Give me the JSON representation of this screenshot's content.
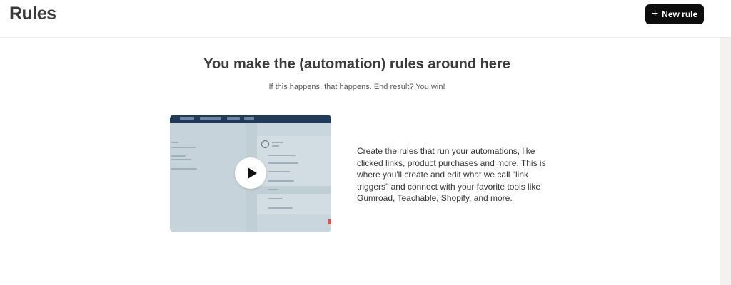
{
  "header": {
    "title": "Rules",
    "new_rule_label": "New rule",
    "new_rule_icon": "plus-icon"
  },
  "hero": {
    "title": "You make the (automation) rules around here",
    "subtitle": "If this happens, that happens. End result? You win!"
  },
  "video": {
    "play_icon": "play-icon"
  },
  "description": "Create the rules that run your automations, like clicked links, product purchases and more. This is where you'll create and edit what we call \"link triggers\" and connect with your favorite tools like Gumroad, Teachable, Shopify, and more.",
  "colors": {
    "button_bg": "#0d0d0d",
    "title_text": "#3b3b3b",
    "video_header": "#203a5a"
  }
}
